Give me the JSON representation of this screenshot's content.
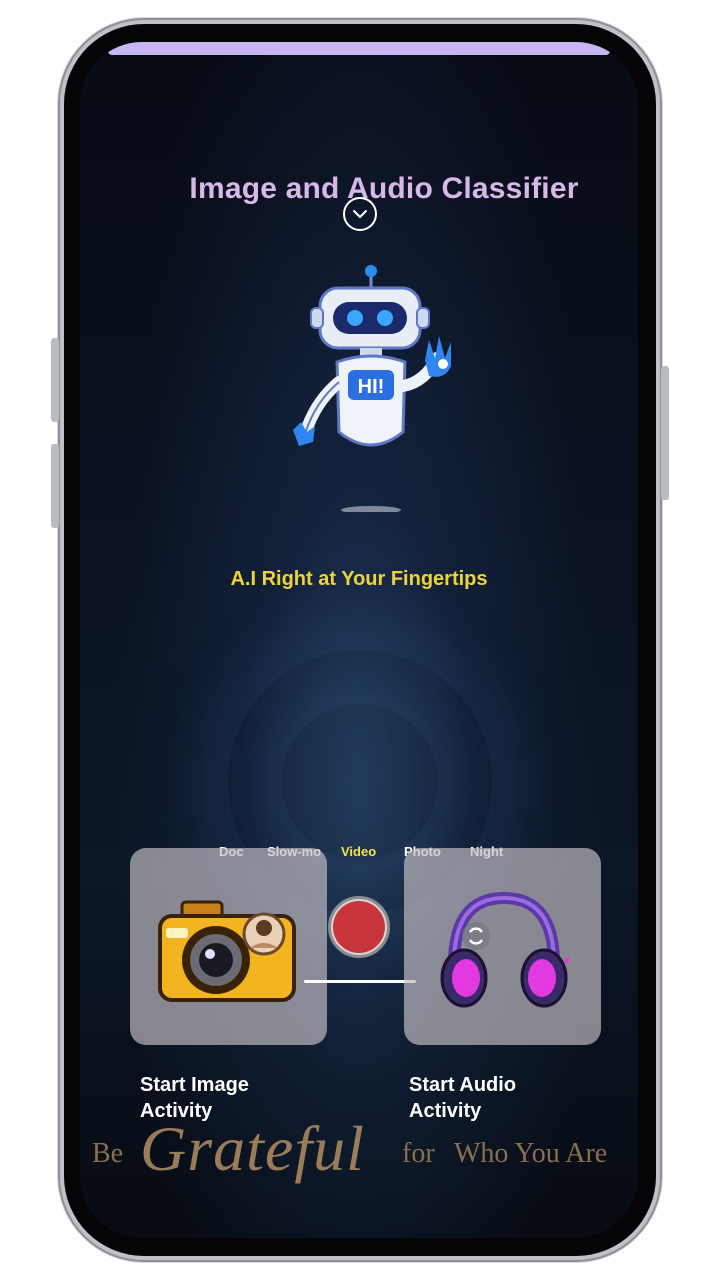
{
  "app": {
    "title": "Image and Audio Classifier",
    "tagline": "A.I Right at Your Fingertips",
    "robot_badge": "HI!"
  },
  "camera_modes": [
    "Doc",
    "Slow-mo",
    "Video",
    "Photo",
    "Night"
  ],
  "active_mode": "Video",
  "cards": {
    "image_label": "Start Image Activity",
    "audio_label": "Start Audio Activity"
  },
  "quote": {
    "be": "Be",
    "script": "Grateful",
    "for": "for",
    "rest": "Who You Are"
  },
  "colors": {
    "title": "#d9b7e8",
    "tagline": "#f0d33a",
    "active_mode": "#f3e34c",
    "shutter": "#c8353b",
    "top_strip": "#c8b6f4",
    "quote": "#8a6f4e"
  },
  "icons": {
    "expand": "chevron-down-icon",
    "camera": "camera-icon",
    "audio": "headphones-icon",
    "flip": "flip-camera-icon"
  }
}
